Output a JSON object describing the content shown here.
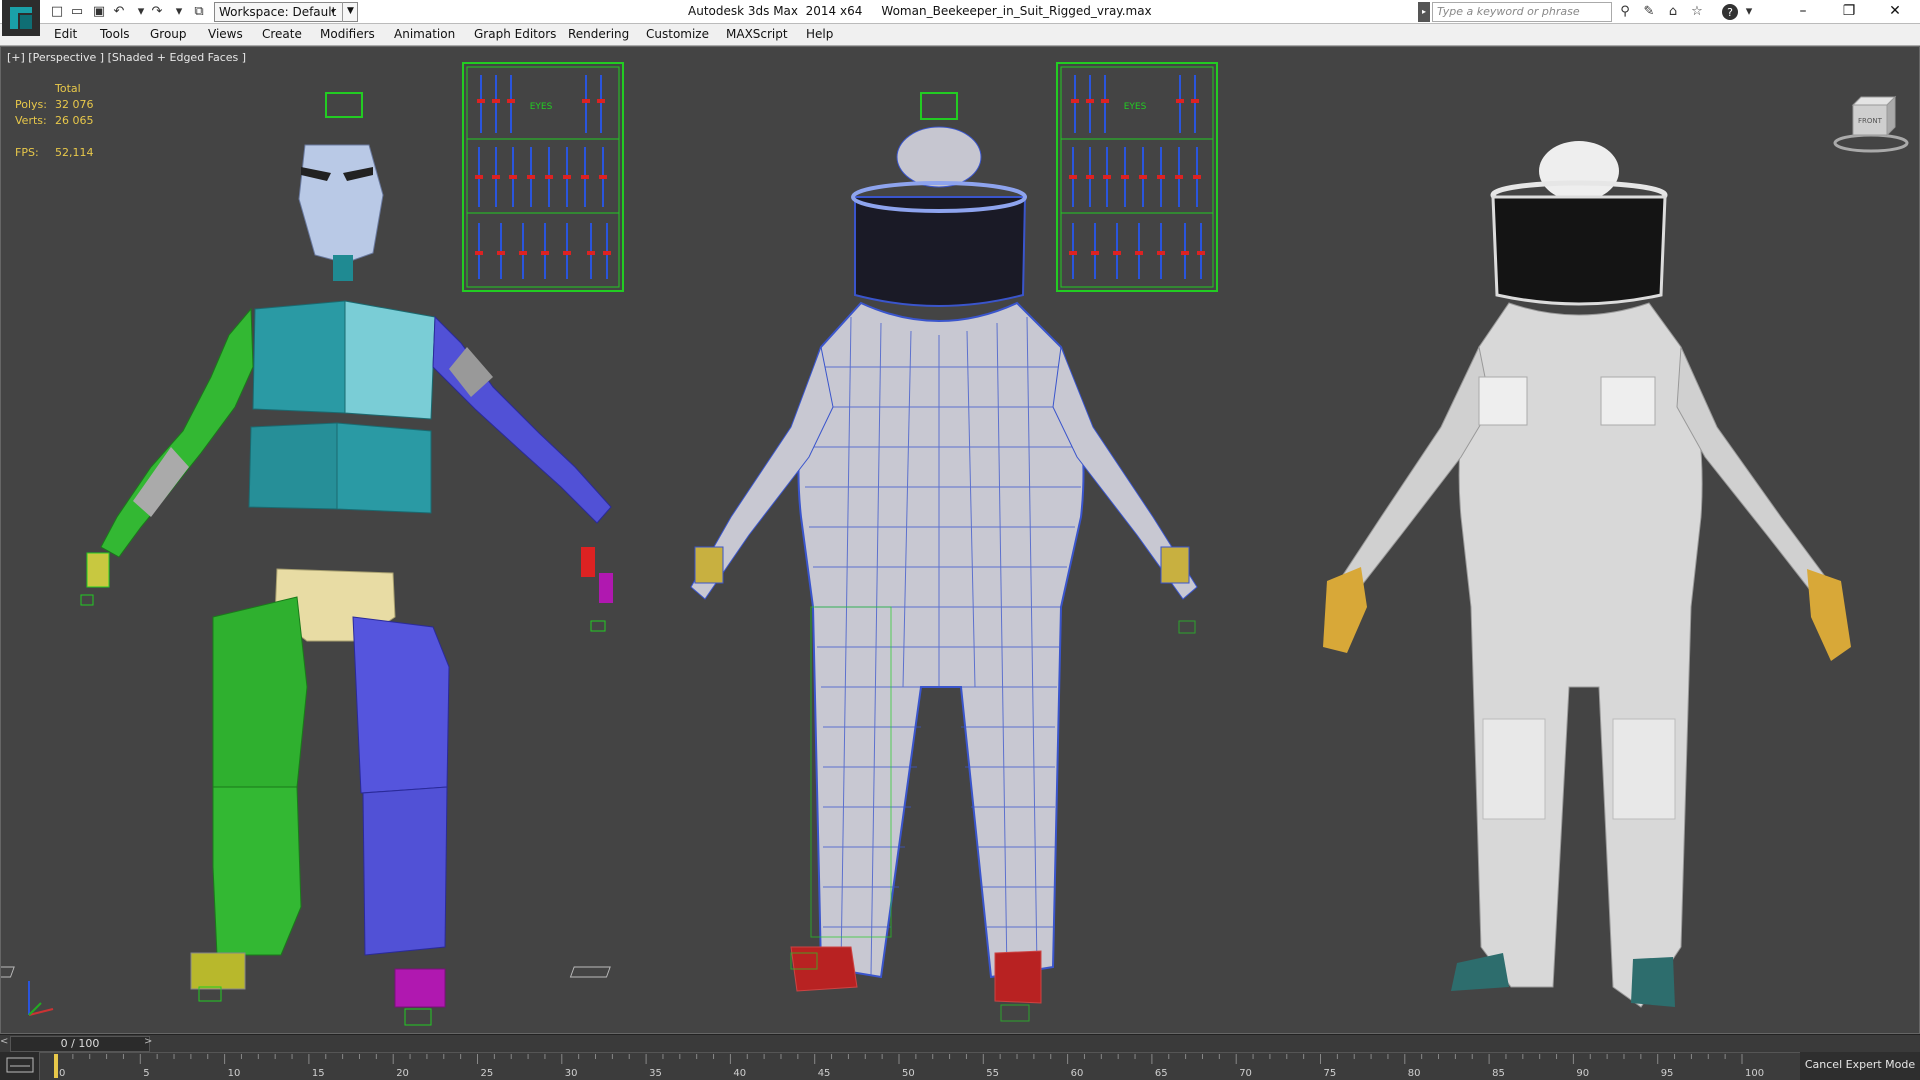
{
  "titlebar": {
    "workspace_label": "Workspace: Default",
    "app_title": "Autodesk 3ds Max  2014 x64     Woman_Beekeeper_in_Suit_Rigged_vray.max",
    "search_placeholder": "Type a keyword or phrase",
    "help_icon": "?"
  },
  "menu": [
    "Edit",
    "Tools",
    "Group",
    "Views",
    "Create",
    "Modifiers",
    "Animation",
    "Graph Editors",
    "Rendering",
    "Customize",
    "MAXScript",
    "Help"
  ],
  "viewport": {
    "label": "[+] [Perspective ] [Shaded + Edged Faces ]",
    "stats": {
      "header": "Total",
      "polys_label": "Polys:",
      "polys_value": "32 076",
      "verts_label": "Verts:",
      "verts_value": "26 065",
      "fps_label": "FPS:",
      "fps_value": "52,114"
    },
    "panel_text": "EYES",
    "viewcube_label": "FRONT"
  },
  "timeline": {
    "frame_counter": "0 / 100",
    "ticks": [
      "0",
      "5",
      "10",
      "15",
      "20",
      "25",
      "30",
      "35",
      "40",
      "45",
      "50",
      "55",
      "60",
      "65",
      "70",
      "75",
      "80",
      "85",
      "90",
      "95",
      "100"
    ]
  },
  "status": {
    "cancel_expert": "Cancel Expert Mode"
  },
  "colors": {
    "viewport_bg": "#444444",
    "stats_color": "#e8c84a",
    "rig_green": "#2fa82f",
    "rig_blue": "#4a4ad0",
    "rig_teal": "#28929c"
  }
}
